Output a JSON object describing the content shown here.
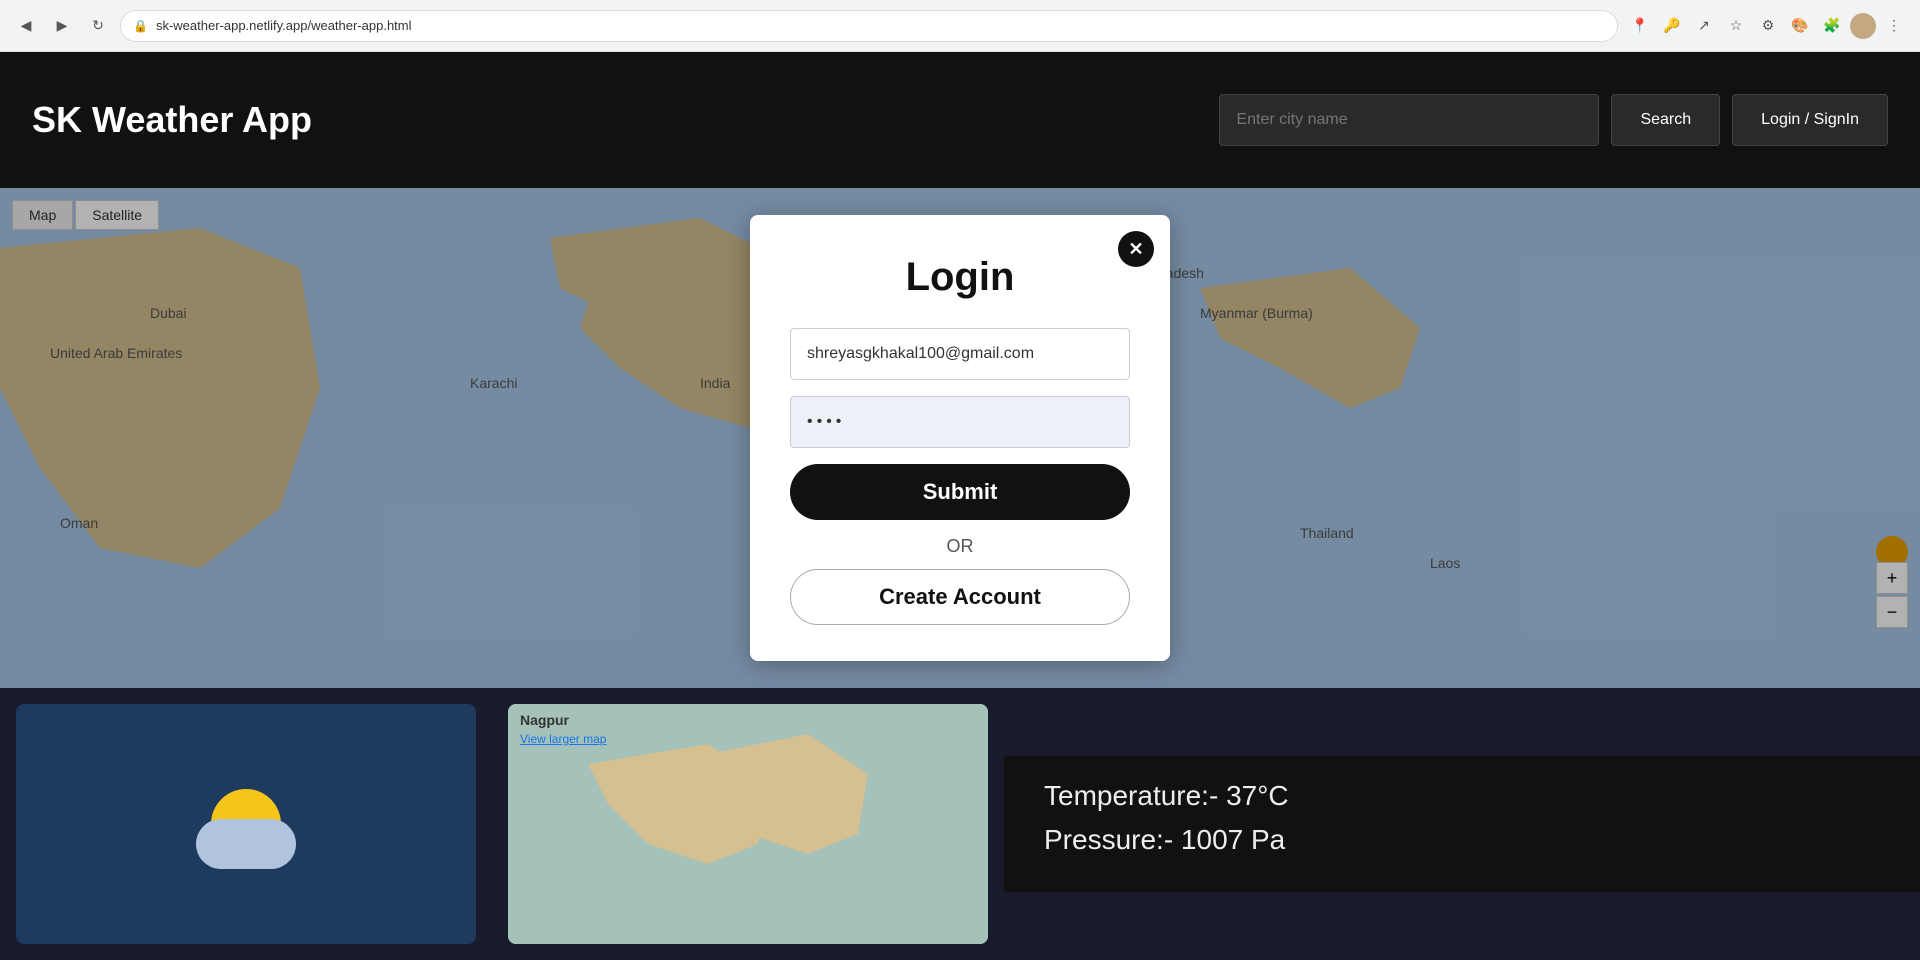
{
  "browser": {
    "url": "sk-weather-app.netlify.app/weather-app.html",
    "back_icon": "◀",
    "forward_icon": "▶",
    "reload_icon": "↻",
    "lock_icon": "🔒"
  },
  "header": {
    "title": "SK Weather App",
    "search_placeholder": "Enter city name",
    "search_label": "Search",
    "login_label": "Login / SignIn"
  },
  "map": {
    "control_map": "Map",
    "control_satellite": "Satellite"
  },
  "modal": {
    "title": "Login",
    "close_icon": "✕",
    "email_value": "shreyasgkhakal100@gmail.com",
    "password_value": "••••",
    "submit_label": "Submit",
    "or_text": "OR",
    "create_account_label": "Create Account"
  },
  "bottom": {
    "city_name": "Nagpur",
    "map_link": "View larger map",
    "temperature": "Temperature:- 37°C",
    "pressure": "Pressure:- 1007 Pa"
  }
}
